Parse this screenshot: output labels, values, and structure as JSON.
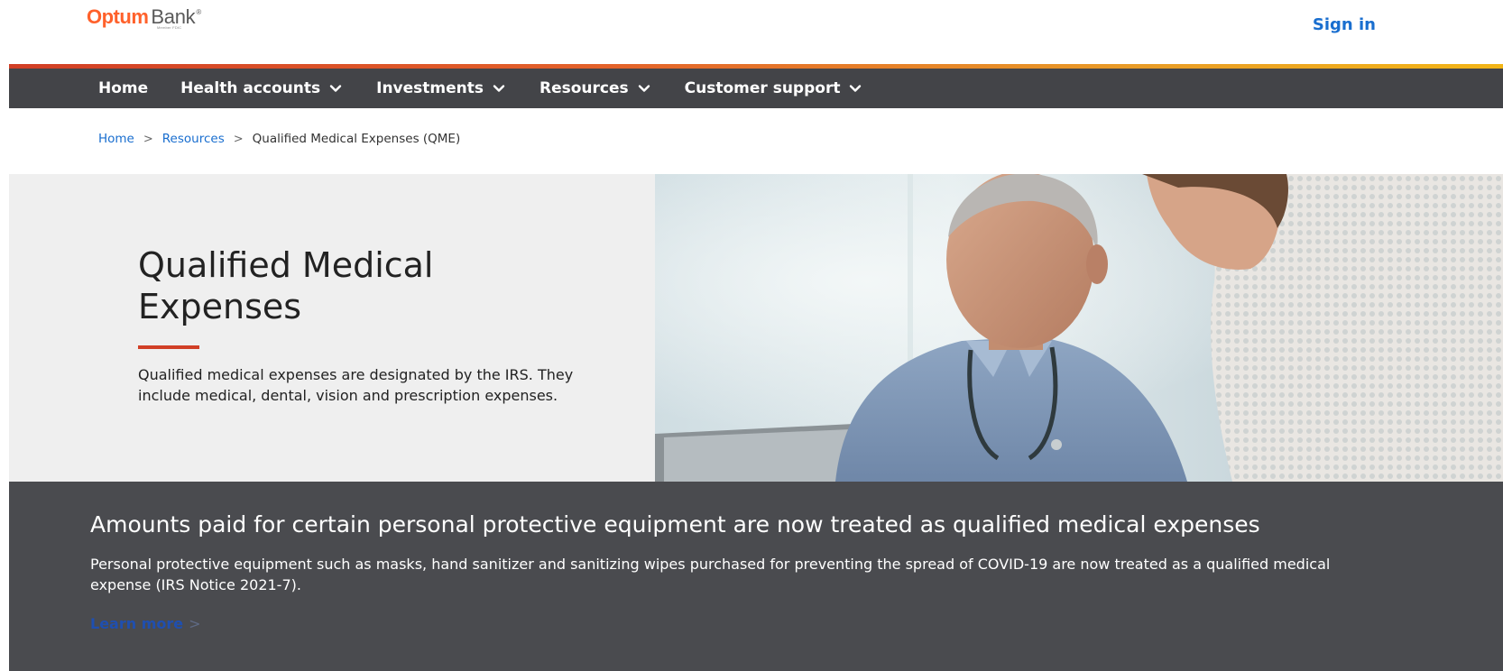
{
  "header": {
    "logo": {
      "brand": "Optum",
      "product": "Bank",
      "mark": "®",
      "sub": "Member FDIC"
    },
    "sign_in": "Sign in"
  },
  "colors": {
    "brand_orange": "#ff612b",
    "link_blue": "#196ecf",
    "nav_bg": "#434448",
    "banner_bg": "#4a4b4f",
    "accent_red": "#d13f26"
  },
  "nav": {
    "items": [
      {
        "label": "Home",
        "has_dropdown": false
      },
      {
        "label": "Health accounts",
        "has_dropdown": true
      },
      {
        "label": "Investments",
        "has_dropdown": true
      },
      {
        "label": "Resources",
        "has_dropdown": true
      },
      {
        "label": "Customer support",
        "has_dropdown": true
      }
    ],
    "dropdown_icon": "chevron-down-icon"
  },
  "breadcrumb": {
    "items": [
      {
        "label": "Home",
        "link": true
      },
      {
        "label": "Resources",
        "link": true
      },
      {
        "label": "Qualified Medical Expenses (QME)",
        "link": false
      }
    ],
    "separator": ">"
  },
  "hero": {
    "title": "Qualified Medical Expenses",
    "description": "Qualified medical expenses are designated by the IRS. They include medical, dental, vision and prescription expenses."
  },
  "banner": {
    "title": "Amounts paid for certain personal protective equipment are now treated as qualified medical expenses",
    "body": "Personal protective equipment such as masks, hand sanitizer and sanitizing wipes purchased for preventing the spread of COVID-19 are now treated as a qualified medical expense (IRS Notice 2021-7).",
    "link_label": "Learn more",
    "link_arrow": ">"
  }
}
